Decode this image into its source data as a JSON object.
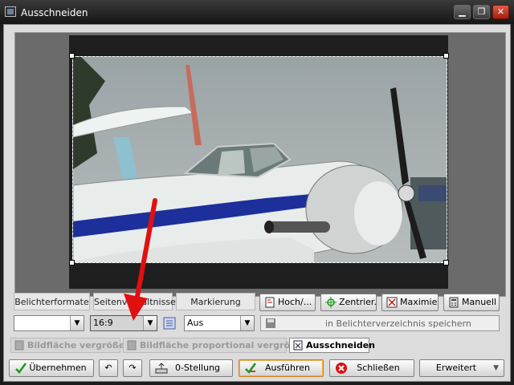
{
  "window": {
    "title": "Ausschneiden",
    "minimize_label": "▁",
    "restore_label": "❐",
    "close_label": "✕"
  },
  "panel_tabs": {
    "belichterformate": "Belichterformate",
    "seitenverhaeltnisse": "Seitenverhältnisse",
    "markierung": "Markierung"
  },
  "tool_buttons": {
    "hoch": "Hoch/...",
    "zentrieren": "Zentrier...",
    "maximieren": "Maximie...",
    "manuell": "Manuell"
  },
  "selects": {
    "format_value": "",
    "ratio_value": "16:9",
    "markierung_value": "Aus"
  },
  "save_field": {
    "label": "in Belichterverzeichnis speichern"
  },
  "mode_tabs": {
    "vergroessern": "Bildfläche vergrößern",
    "proportional": "Bildfläche proportional vergrößern",
    "ausschneiden": "Ausschneiden"
  },
  "bottom_buttons": {
    "uebernehmen": "Übernehmen",
    "undo": "↶",
    "redo": "↷",
    "nullstellung": "0-Stellung",
    "ausfuehren": "Ausführen",
    "schliessen": "Schließen",
    "erweitert": "Erweitert",
    "erweitert_arrow": "▼"
  },
  "colors": {
    "accent_red": "#e01010",
    "check_green": "#1a9a1a",
    "dark_bg": "#1c1c1c"
  }
}
